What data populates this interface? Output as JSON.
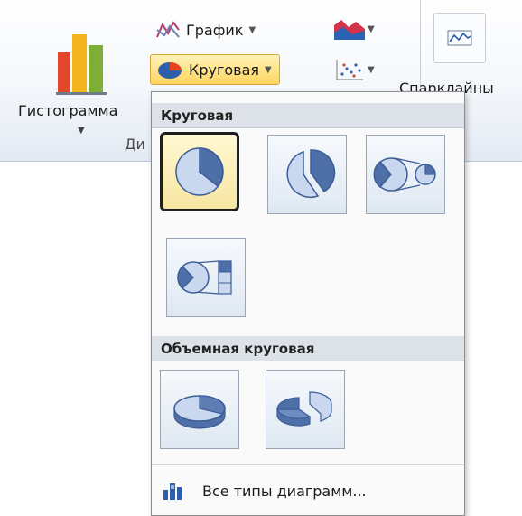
{
  "ribbon": {
    "histogram_label": "Гистограмма",
    "grafik_label": "График",
    "krugovaya_label": "Круговая",
    "sparklines_label": "Спарклайны",
    "group_label": "Ди"
  },
  "dropdown": {
    "section1_title": "Круговая",
    "section2_title": "Объемная круговая",
    "footer_label": "Все типы диаграмм..."
  },
  "colors": {
    "pie_light": "#c9d8ee",
    "pie_dark": "#4f6fa8",
    "selected_bg": "#f7e6a2"
  }
}
